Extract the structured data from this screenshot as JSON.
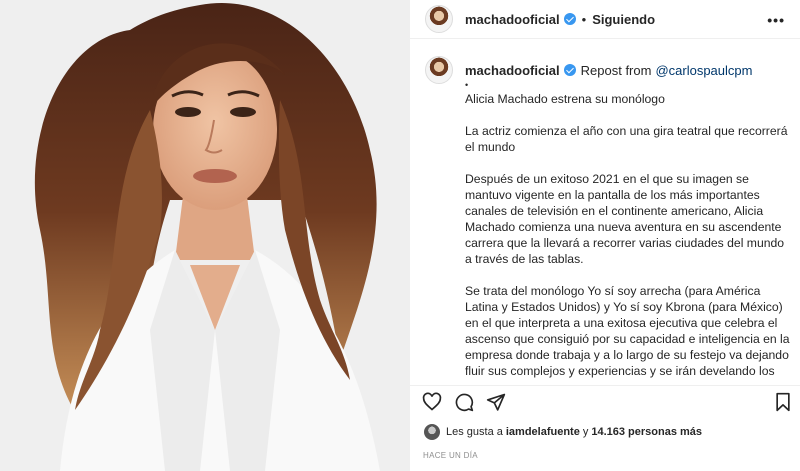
{
  "header": {
    "username": "machadooficial",
    "separator": "•",
    "follow_status": "Siguiendo",
    "more": "•••"
  },
  "caption": {
    "username": "machadooficial",
    "repost_prefix": "Repost from",
    "mention": "@carlospaulcpm",
    "bullet": "•",
    "paragraphs": [
      "Alicia Machado estrena su monólogo",
      "La actriz comienza el año con una gira teatral que recorrerá el mundo",
      "Después de un exitoso 2021 en el que su imagen se mantuvo vigente en la pantalla de los más importantes canales de televisión en el continente americano, Alicia Machado comienza una nueva aventura en su ascendente carrera que la llevará a  recorrer varias ciudades del mundo a través de las tablas.",
      "Se trata del monólogo Yo sí soy arrecha (para América Latina y Estados Unidos) y Yo sí soy Kbrona (para México) en el que interpreta a una exitosa ejecutiva que celebra el ascenso que consiguió por su capacidad e inteligencia en la empresa donde trabaja y a lo largo de su festejo va dejando fluir sus complejos y experiencias y se irán develando los estragos que ha ocasionado a lo largo de su vida el consumo de alcohol, todo actuado en tono de tragicomedia."
    ]
  },
  "actions": {
    "icons": [
      "heart-icon",
      "comment-icon",
      "share-icon",
      "bookmark-icon"
    ]
  },
  "likes": {
    "prefix": "Les gusta a",
    "user": "iamdelafuente",
    "connector": "y",
    "count": "14.163 personas más"
  },
  "timestamp": "HACE UN DÍA",
  "colors": {
    "text": "#262626",
    "link": "#00376b",
    "verified": "#3897f0",
    "muted": "#8e8e8e",
    "border": "#efefef"
  }
}
